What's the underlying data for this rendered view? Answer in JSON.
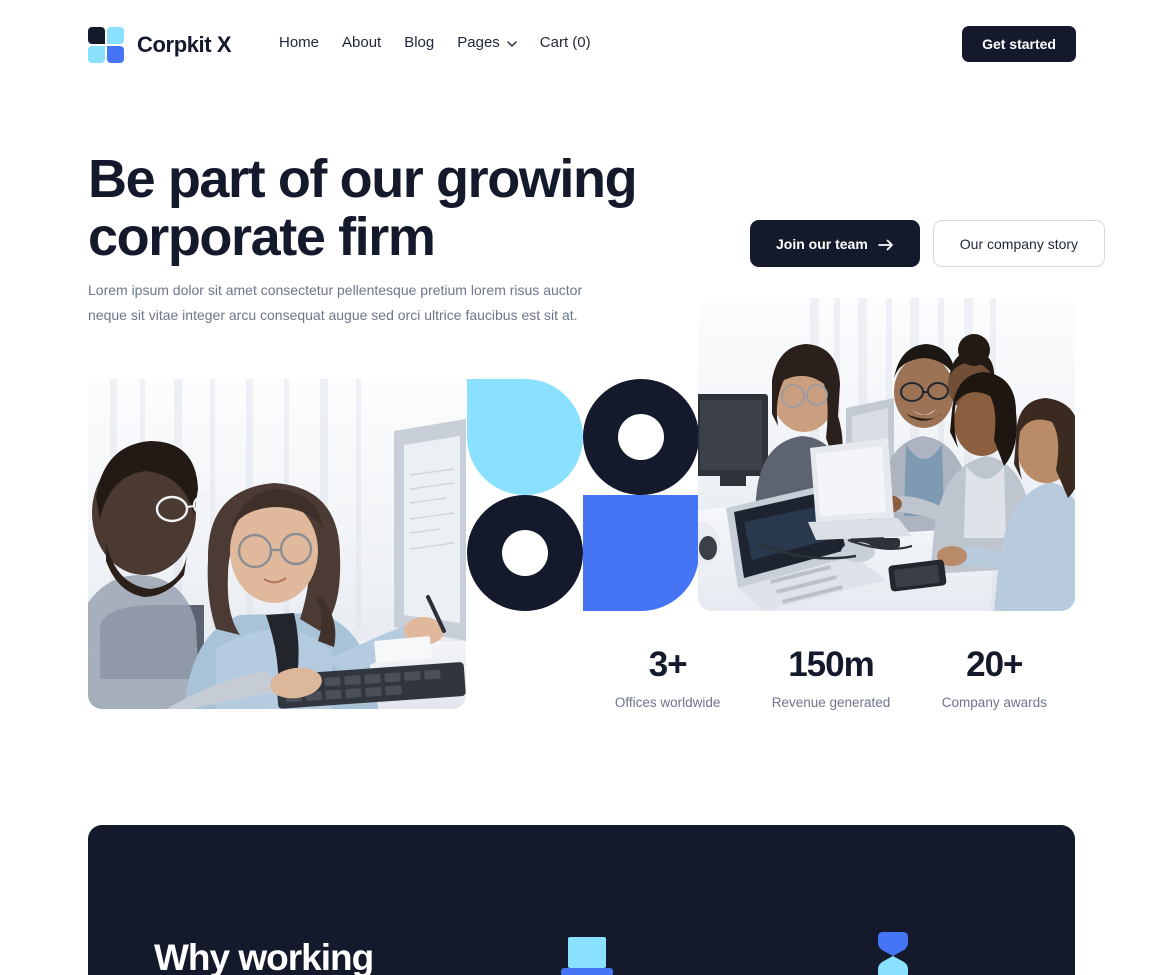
{
  "header": {
    "brand_name": "Corpkit X",
    "logo_icon": "logo-grid-icon",
    "nav": [
      {
        "label": "Home",
        "icon": null
      },
      {
        "label": "About",
        "icon": null
      },
      {
        "label": "Blog",
        "icon": null
      },
      {
        "label": "Pages",
        "icon": "chevron-down-icon"
      },
      {
        "label": "Cart (0)",
        "icon": null
      }
    ],
    "cta_label": "Get started"
  },
  "hero": {
    "title": "Be part of our growing corporate firm",
    "subtitle": "Lorem ipsum dolor sit amet consectetur pellentesque pretium lorem risus auctor neque sit vitae integer arcu consequat augue sed orci ultrice faucibus est sit at.",
    "primary_cta": "Join our team",
    "primary_cta_icon": "arrow-right-icon",
    "secondary_cta": "Our company story",
    "image_left_alt": "Two colleagues reviewing work at a desktop computer",
    "image_right_alt": "Team of four collaborating around an office table with laptops"
  },
  "stats": [
    {
      "value": "3+",
      "label": "Offices worldwide"
    },
    {
      "value": "150m",
      "label": "Revenue generated"
    },
    {
      "value": "20+",
      "label": "Company awards"
    }
  ],
  "dark_section": {
    "title": "Why working",
    "icons": [
      {
        "name": "laptop-icon"
      },
      {
        "name": "hourglass-icon"
      }
    ]
  },
  "colors": {
    "navy": "#141a2b",
    "blue": "#4574f5",
    "light_blue": "#89e0ff",
    "muted_text": "#6e7689",
    "border": "#d5d9e2",
    "background": "#ffffff"
  }
}
